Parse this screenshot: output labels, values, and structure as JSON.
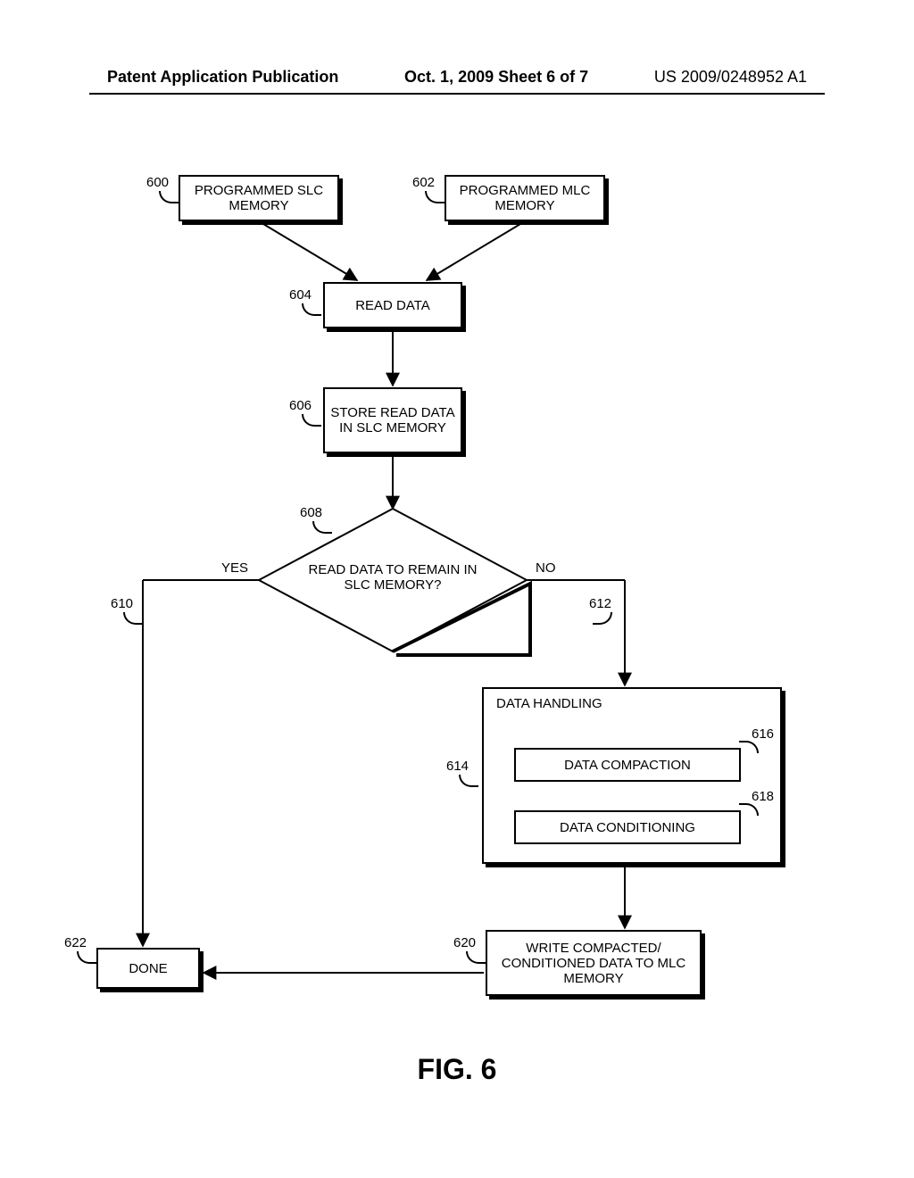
{
  "header": {
    "left": "Patent Application Publication",
    "mid": "Oct. 1, 2009  Sheet 6 of 7",
    "right": "US 2009/0248952 A1"
  },
  "refs": {
    "r600": "600",
    "r602": "602",
    "r604": "604",
    "r606": "606",
    "r608": "608",
    "r610": "610",
    "r612": "612",
    "r614": "614",
    "r616": "616",
    "r618": "618",
    "r620": "620",
    "r622": "622"
  },
  "boxes": {
    "b600": "PROGRAMMED SLC MEMORY",
    "b602": "PROGRAMMED MLC MEMORY",
    "b604": "READ DATA",
    "b606": "STORE READ DATA IN SLC MEMORY",
    "b608": "READ DATA TO REMAIN IN SLC MEMORY?",
    "dh_label": "DATA HANDLING",
    "b616": "DATA COMPACTION",
    "b618": "DATA CONDITIONING",
    "b620": "WRITE COMPACTED/ CONDITIONED DATA TO MLC MEMORY",
    "b622": "DONE"
  },
  "branches": {
    "yes": "YES",
    "no": "NO"
  },
  "figure": "FIG. 6",
  "chart_data": {
    "type": "flowchart",
    "title": "FIG. 6",
    "nodes": [
      {
        "id": "600",
        "label": "PROGRAMMED SLC MEMORY",
        "kind": "start"
      },
      {
        "id": "602",
        "label": "PROGRAMMED MLC MEMORY",
        "kind": "start"
      },
      {
        "id": "604",
        "label": "READ DATA",
        "kind": "process"
      },
      {
        "id": "606",
        "label": "STORE READ DATA IN SLC MEMORY",
        "kind": "process"
      },
      {
        "id": "608",
        "label": "READ DATA TO REMAIN IN SLC MEMORY?",
        "kind": "decision"
      },
      {
        "id": "614",
        "label": "DATA HANDLING",
        "kind": "container",
        "children": [
          "616",
          "618"
        ]
      },
      {
        "id": "616",
        "label": "DATA COMPACTION",
        "kind": "process"
      },
      {
        "id": "618",
        "label": "DATA CONDITIONING",
        "kind": "process"
      },
      {
        "id": "620",
        "label": "WRITE COMPACTED/ CONDITIONED DATA TO MLC MEMORY",
        "kind": "process"
      },
      {
        "id": "622",
        "label": "DONE",
        "kind": "terminator"
      }
    ],
    "edges": [
      {
        "from": "600",
        "to": "604"
      },
      {
        "from": "602",
        "to": "604"
      },
      {
        "from": "604",
        "to": "606"
      },
      {
        "from": "606",
        "to": "608"
      },
      {
        "from": "608",
        "to": "622",
        "label": "YES"
      },
      {
        "from": "608",
        "to": "614",
        "label": "NO",
        "via": "612"
      },
      {
        "from": "614",
        "to": "620"
      },
      {
        "from": "616",
        "to": "618"
      },
      {
        "from": "620",
        "to": "622"
      }
    ],
    "refs": {
      "610": "YES branch leader",
      "612": "NO branch leader"
    }
  }
}
